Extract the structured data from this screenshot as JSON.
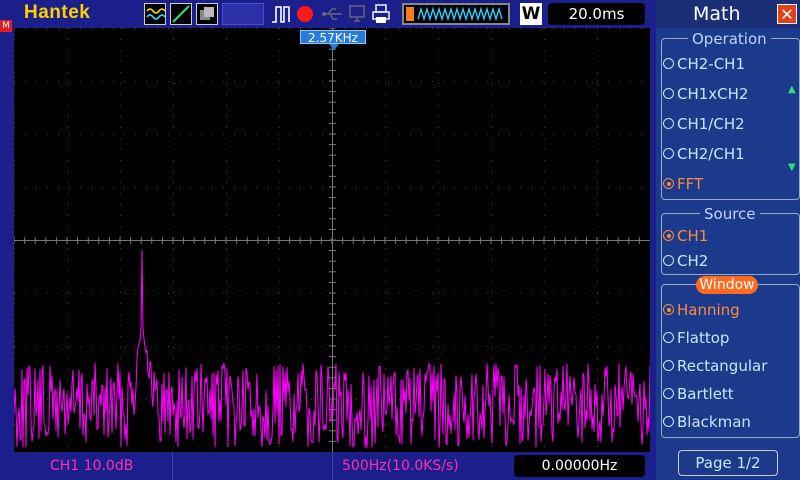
{
  "header": {
    "brand": "Hantek",
    "timebase": "20.0ms",
    "w_label": "W"
  },
  "screen": {
    "marker_freq": "2.57KHz"
  },
  "footer": {
    "ch1_scale": "CH1 10.0dB",
    "sample_rate": "500Hz(10.0KS/s)",
    "cursor_freq": "0.00000Hz"
  },
  "math_panel": {
    "title": "Math",
    "operation": {
      "title": "Operation",
      "options": [
        "CH2-CH1",
        "CH1xCH2",
        "CH1/CH2",
        "CH2/CH1",
        "FFT"
      ],
      "selected": "FFT"
    },
    "source": {
      "title": "Source",
      "options": [
        "CH1",
        "CH2"
      ],
      "selected": "CH1"
    },
    "window": {
      "title": "Window",
      "options": [
        "Hanning",
        "Flattop",
        "Rectangular",
        "Bartlett",
        "Blackman"
      ],
      "selected": "Hanning"
    },
    "page": "Page 1/2"
  },
  "colors": {
    "trace": "#ff00ff",
    "accent": "#ff6a20",
    "bar": "#1b1f8c"
  },
  "icons": [
    "wave-icon",
    "trigger-slope-icon",
    "display-mode-icon",
    "pulse-icon",
    "record-icon",
    "usb-icon",
    "print-icon",
    "waveform-memory-icon"
  ]
}
